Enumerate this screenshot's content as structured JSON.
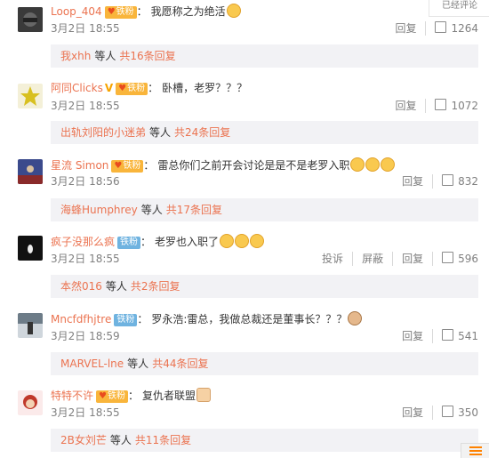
{
  "top_corner": {
    "label": "已经评论"
  },
  "comments": [
    {
      "user": "Loop_404",
      "badge": "铁粉",
      "badge_type": "fan",
      "vip": false,
      "text": "我愿称之为绝活",
      "emojis": [
        "smile"
      ],
      "time": "3月2日 18:55",
      "actions": [
        "回复"
      ],
      "likes": "1264",
      "replies": {
        "names": "我xhh",
        "tail": "等人",
        "count": "共16条回复"
      }
    },
    {
      "user": "阿同Clicks",
      "badge": "铁粉",
      "badge_type": "fan",
      "vip": true,
      "text": "卧槽，老罗？？？",
      "emojis": [],
      "time": "3月2日 18:55",
      "actions": [
        "回复"
      ],
      "likes": "1072",
      "replies": {
        "names": "出轨刘阳的小迷弟",
        "tail": "等人",
        "count": "共24条回复"
      }
    },
    {
      "user": "星流 Simon",
      "badge": "铁粉",
      "badge_type": "fan",
      "vip": false,
      "text": "雷总你们之前开会讨论是是不是老罗入职",
      "emojis": [
        "smile",
        "smile",
        "smile"
      ],
      "time": "3月2日 18:56",
      "actions": [
        "回复"
      ],
      "likes": "832",
      "replies": {
        "names": "海蜂Humphrey",
        "tail": "等人",
        "count": "共17条回复"
      }
    },
    {
      "user": "疯子没那么疯",
      "badge": "铁粉",
      "badge_type": "blue",
      "vip": false,
      "text": "老罗也入职了",
      "emojis": [
        "smile",
        "smile",
        "smile"
      ],
      "time": "3月2日 18:55",
      "actions": [
        "投诉",
        "屏蔽",
        "回复"
      ],
      "likes": "596",
      "replies": {
        "names": "本然016",
        "tail": "等人",
        "count": "共2条回复"
      }
    },
    {
      "user": "Mncfdfhjtre",
      "badge": "铁粉",
      "badge_type": "blue",
      "vip": false,
      "text": "罗永浩:雷总，我做总裁还是董事长？？？",
      "emojis": [
        "cat"
      ],
      "time": "3月2日 18:59",
      "actions": [
        "回复"
      ],
      "likes": "541",
      "replies": {
        "names": "MARVEL-lne",
        "tail": "等人",
        "count": "共44条回复"
      }
    },
    {
      "user": "特特不许",
      "badge": "铁粉",
      "badge_type": "fan",
      "vip": false,
      "text": "复仇者联盟",
      "emojis": [
        "hand"
      ],
      "time": "3月2日 18:55",
      "actions": [
        "回复"
      ],
      "likes": "350",
      "replies": {
        "names": "2B女刘芒",
        "tail": "等人",
        "count": "共11条回复"
      }
    }
  ]
}
